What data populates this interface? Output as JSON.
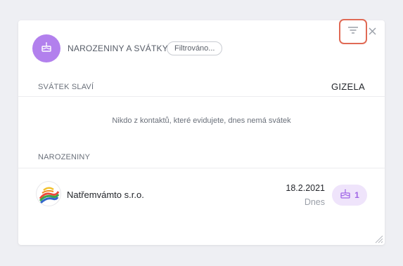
{
  "widget": {
    "title": "NAROZENINY A SVÁTKY",
    "filter_pill": "Filtrováno...",
    "icons": {
      "header": "cake-icon",
      "filter": "filter-icon",
      "close": "close-icon",
      "badge": "cake-icon",
      "resize": "resize-handle-icon"
    },
    "accent_color": "#b280ed",
    "filter_highlight_color": "#e06a55"
  },
  "nameday": {
    "label": "SVÁTEK SLAVÍ",
    "name": "GIZELA",
    "empty_message": "Nikdo z kontaktů, které evidujete, dnes nemá svátek"
  },
  "birthdays": {
    "label": "NAROZENINY",
    "items": [
      {
        "name": "Natřemvámto s.r.o.",
        "date": "18.2.2021",
        "when": "Dnes",
        "count": "1"
      }
    ]
  }
}
